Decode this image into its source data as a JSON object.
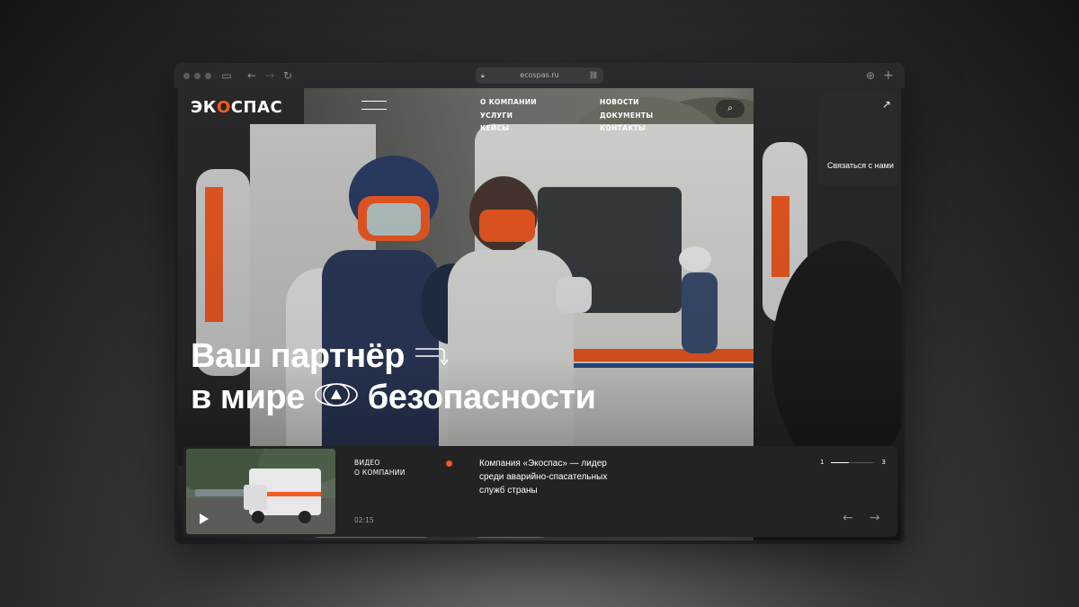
{
  "browser": {
    "url": "ecospas.ru",
    "icons": [
      "sidebar-icon",
      "back-icon",
      "forward-icon",
      "reload-icon",
      "lock-icon",
      "link-icon",
      "download-icon",
      "new-tab-icon"
    ]
  },
  "brand": {
    "logo_prefix": "ЭК",
    "logo_o": "О",
    "logo_suffix": "СПАС",
    "accent": "#f15a24"
  },
  "nav": {
    "col1": [
      "О КОМПАНИИ",
      "УСЛУГИ",
      "КЕЙСЫ"
    ],
    "col2": [
      "НОВОСТИ",
      "ДОКУМЕНТЫ",
      "КОНТАКТЫ"
    ]
  },
  "contact": {
    "label": "Связаться с нами"
  },
  "hero": {
    "line1": "Ваш партнёр",
    "line2_a": "в мире",
    "line2_b": "безопасности"
  },
  "video": {
    "label_line1": "ВИДЕО",
    "label_line2": "О КОМПАНИИ",
    "duration": "02:15",
    "description": "Компания «Экоспас» — лидер среди аварийно-спасательных служб страны"
  },
  "pager": {
    "current": "1",
    "total": "3",
    "progress": 0.4
  }
}
